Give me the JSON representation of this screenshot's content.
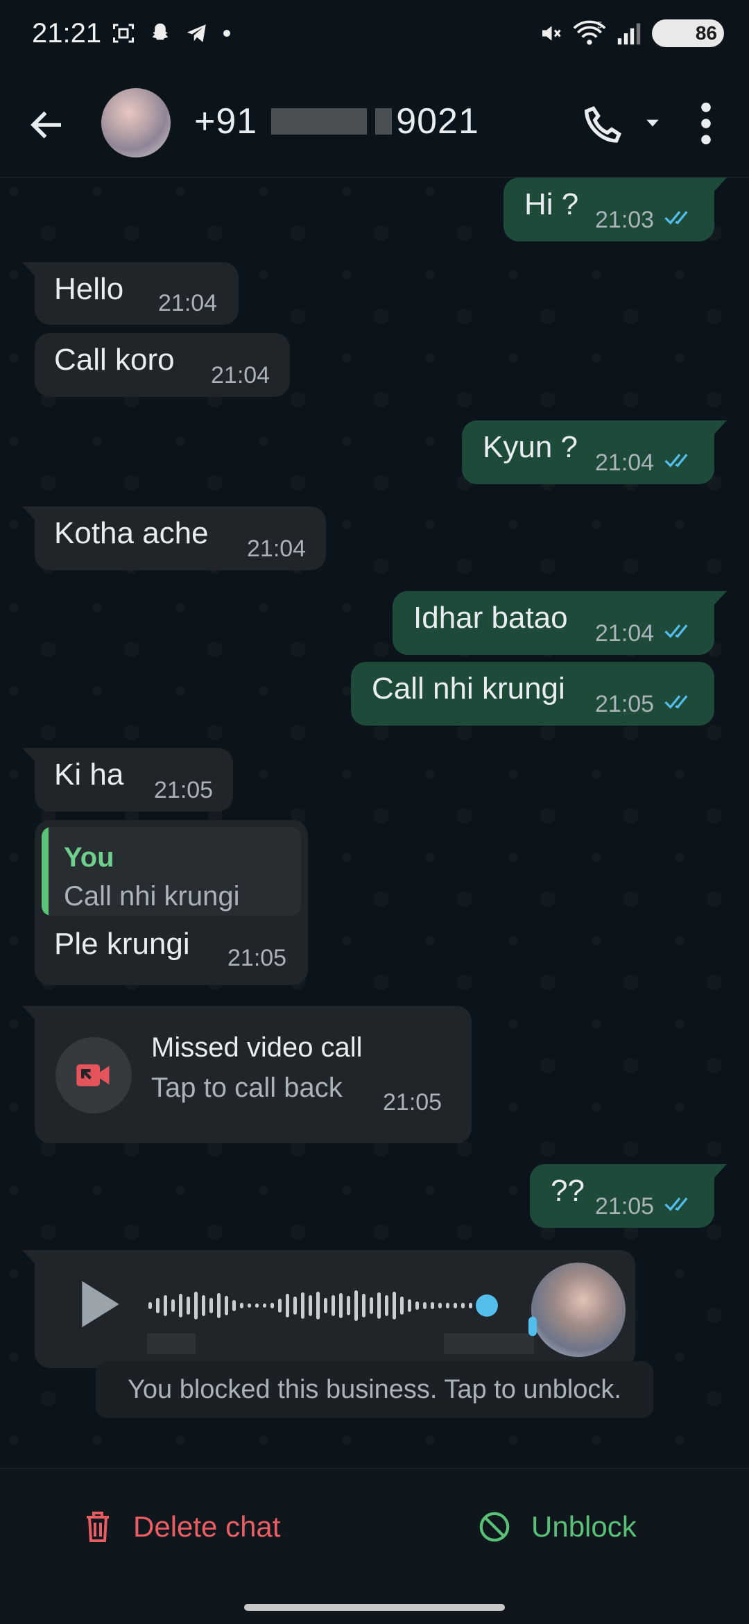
{
  "status_bar": {
    "time": "21:21",
    "battery": "86",
    "network": "5"
  },
  "header": {
    "contact_prefix": "+91",
    "contact_suffix": "9021"
  },
  "messages": [
    {
      "dir": "out",
      "text": "Hi ?",
      "time": "21:03",
      "read": true
    },
    {
      "dir": "in",
      "text": "Hello",
      "time": "21:04"
    },
    {
      "dir": "in",
      "text": "Call koro",
      "time": "21:04"
    },
    {
      "dir": "out",
      "text": "Kyun ?",
      "time": "21:04",
      "read": true
    },
    {
      "dir": "in",
      "text": "Kotha ache",
      "time": "21:04"
    },
    {
      "dir": "out",
      "text": "Idhar batao",
      "time": "21:04",
      "read": true
    },
    {
      "dir": "out",
      "text": "Call nhi krungi",
      "time": "21:05",
      "read": true
    },
    {
      "dir": "in",
      "text": "Ki ha",
      "time": "21:05"
    },
    {
      "dir": "in",
      "quote_author": "You",
      "quote_text": "Call nhi krungi",
      "text": "Ple krungi",
      "time": "21:05"
    },
    {
      "dir": "in",
      "type": "missed_call",
      "title": "Missed video call",
      "subtitle": "Tap to call back",
      "time": "21:05"
    },
    {
      "dir": "out",
      "text": "??",
      "time": "21:05",
      "read": true
    },
    {
      "dir": "in",
      "type": "voice_note"
    }
  ],
  "blocked_notice": "You blocked this business. Tap to unblock.",
  "bottom": {
    "delete_label": "Delete chat",
    "unblock_label": "Unblock"
  },
  "colors": {
    "accent_green": "#58c077",
    "danger_red": "#ea5d63",
    "tick_blue": "#53bdeb",
    "out_bubble": "#1e4a39",
    "in_bubble": "#202529"
  }
}
